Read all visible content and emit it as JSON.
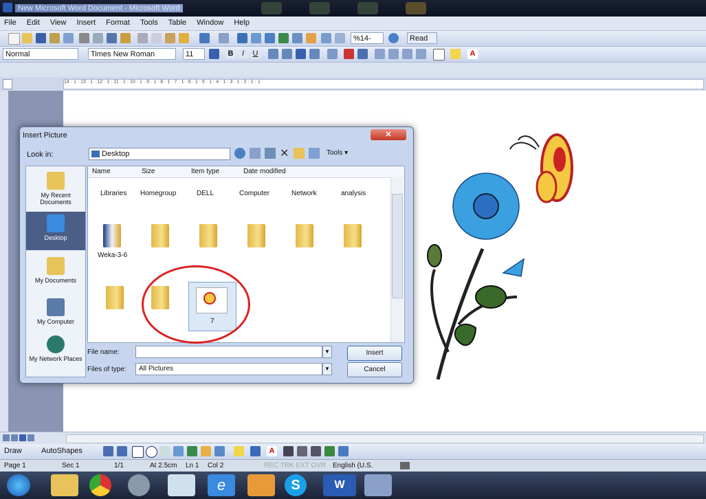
{
  "window": {
    "title": "New Microsoft Word Document - Microsoft Word"
  },
  "menu": [
    "File",
    "Edit",
    "View",
    "Insert",
    "Format",
    "Tools",
    "Table",
    "Window",
    "Help"
  ],
  "formatting": {
    "style": "Normal",
    "font": "Times New Roman",
    "size": "11",
    "zoom": "%14-",
    "read_label": "Read"
  },
  "ruler_text": "14 · 1 · 13 · 1 · 12 · 1 · 11 · 1 · 10 · 1 · 9 · 1 · 8 · 1 · 7 · 1 · 6 · 1 · 5 · 1 · 4 · 1 · 3 · 1 · 2 · 1 · 1",
  "dialog": {
    "title": "Insert Picture",
    "look_in_label": "Look in:",
    "look_in_value": "Desktop",
    "tools_label": "Tools",
    "columns": [
      "Name",
      "Size",
      "Item type",
      "Date modified"
    ],
    "places": [
      "My Recent Documents",
      "Desktop",
      "My Documents",
      "My Computer",
      "My Network Places"
    ],
    "top_items": [
      "Libraries",
      "Homegroup",
      "DELL",
      "Computer",
      "Network",
      "analysis"
    ],
    "folder_label": "Weka-3-6",
    "selected_file": "7",
    "file_name_label": "File name:",
    "file_name_value": "",
    "files_of_type_label": "Files of type:",
    "files_of_type_value": "All Pictures",
    "insert_label": "Insert",
    "cancel_label": "Cancel"
  },
  "draw": {
    "draw_label": "Draw",
    "autoshapes_label": "AutoShapes"
  },
  "status": {
    "page": "Page 1",
    "sec": "Sec 1",
    "count": "1/1",
    "at": "At 2.5cm",
    "ln": "Ln 1",
    "col": "Col 2",
    "flags": "REC TRK EXT OVR",
    "lang": "English (U.S."
  },
  "colors": {
    "accent": "#3a6fb6",
    "circle": "#d22222",
    "flower": "#3aa0e0",
    "butterfly": "#f5c842"
  }
}
